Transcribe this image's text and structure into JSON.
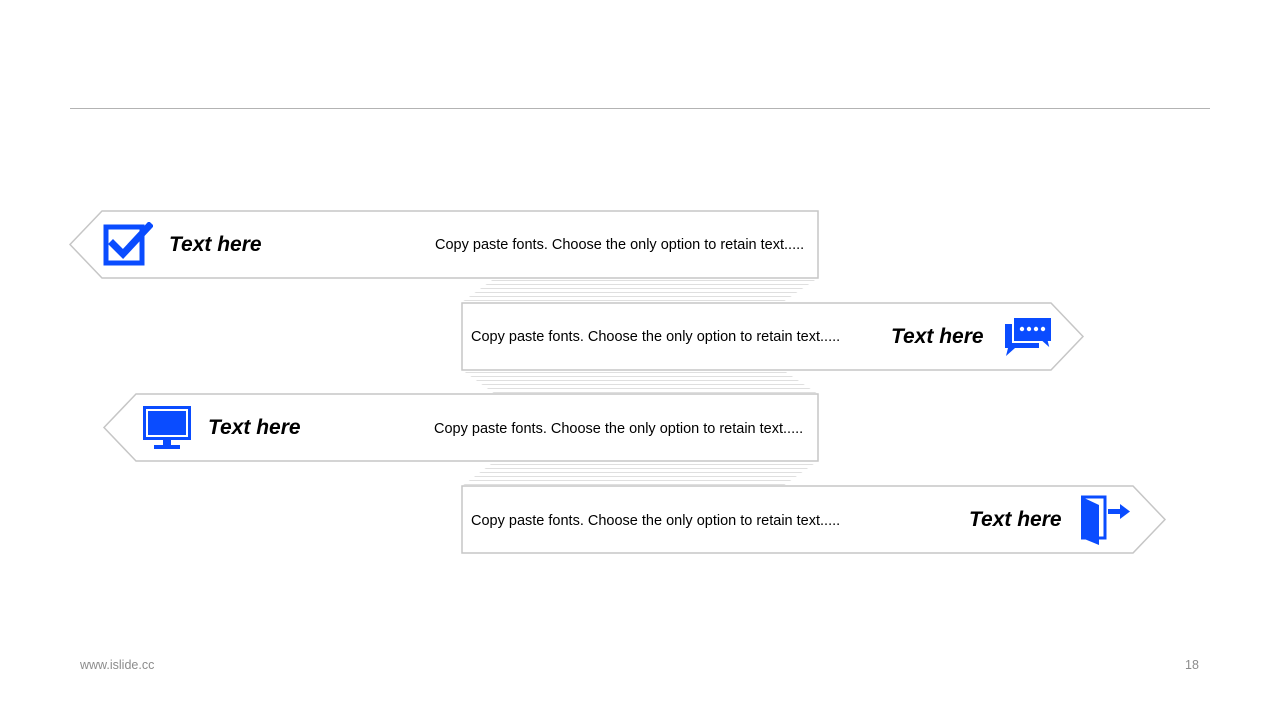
{
  "colors": {
    "accent": "#0a4cff",
    "border": "#c6c6c6",
    "connector": "#e6e6e6",
    "rule": "#b3b3b3",
    "footer_text": "#8c8c8c"
  },
  "items": [
    {
      "title": "Text here",
      "description": "Copy paste fonts. Choose the only option to retain text.....",
      "icon": "checkbox-checked-icon",
      "direction": "left"
    },
    {
      "title": "Text here",
      "description": "Copy paste fonts. Choose the only option to retain text.....",
      "icon": "chat-bubbles-icon",
      "direction": "right"
    },
    {
      "title": "Text here",
      "description": "Copy paste fonts. Choose the only option to retain text.....",
      "icon": "monitor-icon",
      "direction": "left"
    },
    {
      "title": "Text here",
      "description": "Copy paste fonts. Choose the only option to retain text.....",
      "icon": "exit-door-icon",
      "direction": "right"
    }
  ],
  "footer": {
    "website": "www.islide.cc",
    "page_number": "18"
  }
}
